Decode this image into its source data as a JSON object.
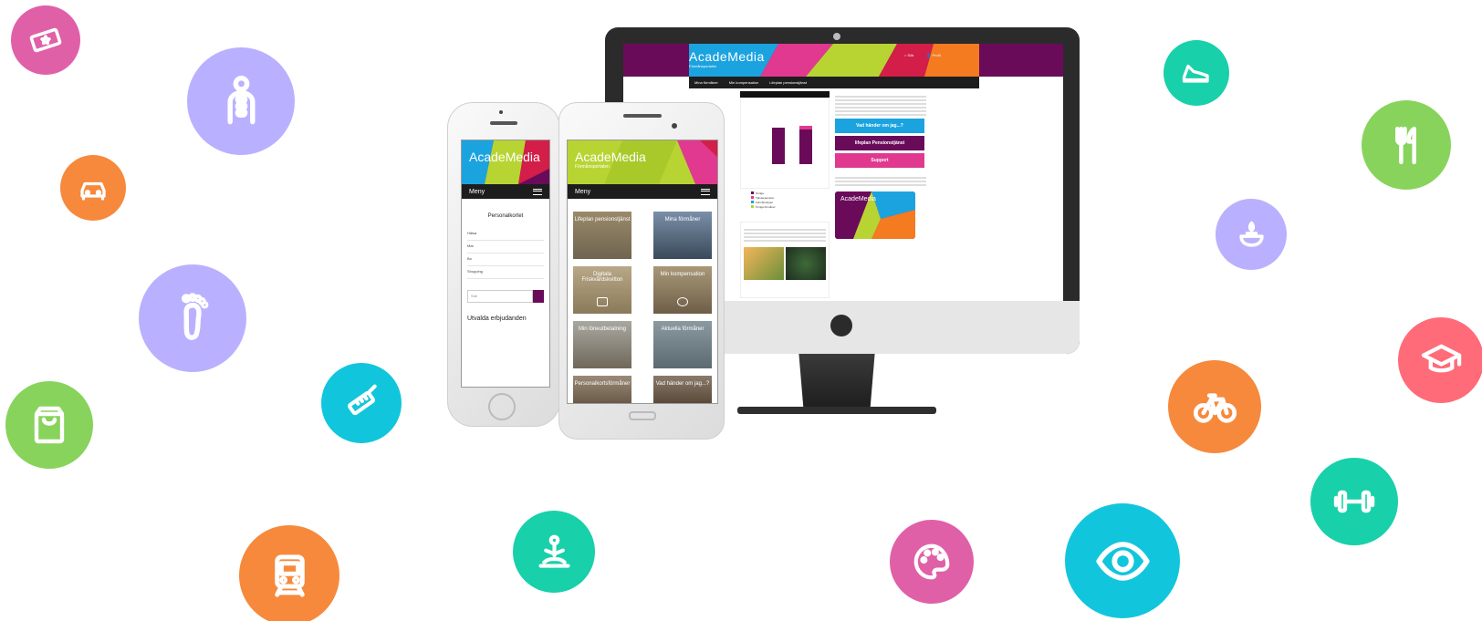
{
  "colors": {
    "purple": "#6a0b5a",
    "magenta": "#e1398f",
    "lime": "#b8d433",
    "blue": "#1ba3e0",
    "orange": "#f47b20",
    "red": "#d21e48"
  },
  "icons": [
    {
      "name": "ticket-icon",
      "color": "#e060a8"
    },
    {
      "name": "spine-icon",
      "color": "#b9b1ff"
    },
    {
      "name": "car-icon",
      "color": "#f6893c"
    },
    {
      "name": "footprint-icon",
      "color": "#b9b1ff"
    },
    {
      "name": "shopping-bag-icon",
      "color": "#88d35c"
    },
    {
      "name": "baby-bottle-icon",
      "color": "#11c6dc"
    },
    {
      "name": "train-icon",
      "color": "#f6893c"
    },
    {
      "name": "yoga-icon",
      "color": "#18d0aa"
    },
    {
      "name": "palette-icon",
      "color": "#e060a8"
    },
    {
      "name": "eye-icon",
      "color": "#11c6dc"
    },
    {
      "name": "dumbbell-icon",
      "color": "#18d0aa"
    },
    {
      "name": "bicycle-icon",
      "color": "#f6893c"
    },
    {
      "name": "graduation-cap-icon",
      "color": "#ff6b78"
    },
    {
      "name": "candle-icon",
      "color": "#b9b1ff"
    },
    {
      "name": "cutlery-icon",
      "color": "#88d35c"
    },
    {
      "name": "running-shoe-icon",
      "color": "#18d0aa"
    }
  ],
  "desktop": {
    "logo": "AcadeMedia",
    "nav": [
      "Mina förmåner",
      "Min kompensation",
      "Lifeplan pensionstjänst"
    ],
    "legend": [
      "Övriga",
      "Tjänstepension",
      "Förmånsbyten",
      "Övriga förmåner"
    ],
    "btn_pension": "Vad händer om jag...?",
    "btn_lifeplan": "lifeplan   Pensionstjänst",
    "btn_support": "Support",
    "card_logo": "AcadeMedia"
  },
  "phone_left": {
    "logo": "AcadeMedia",
    "menu": "Meny",
    "brand": "Personalkortet",
    "rows": [
      "Hälsa",
      "Mat",
      "Bo",
      "Shopping"
    ],
    "search_placeholder": "Sök",
    "heading": "Utvalda erbjudanden"
  },
  "phone_right": {
    "logo": "AcadeMedia",
    "subtitle": "Förmånsportalen",
    "menu": "Meny",
    "tiles": [
      "Lifeplan pensionstjänst",
      "Mina förmåner",
      "Digitala Friskvårdskvitton",
      "Min kompensation",
      "Min löneutbetalning",
      "Aktuella förmåner",
      "Personalkortsförmåner",
      "Vad händer om jag...?"
    ]
  }
}
